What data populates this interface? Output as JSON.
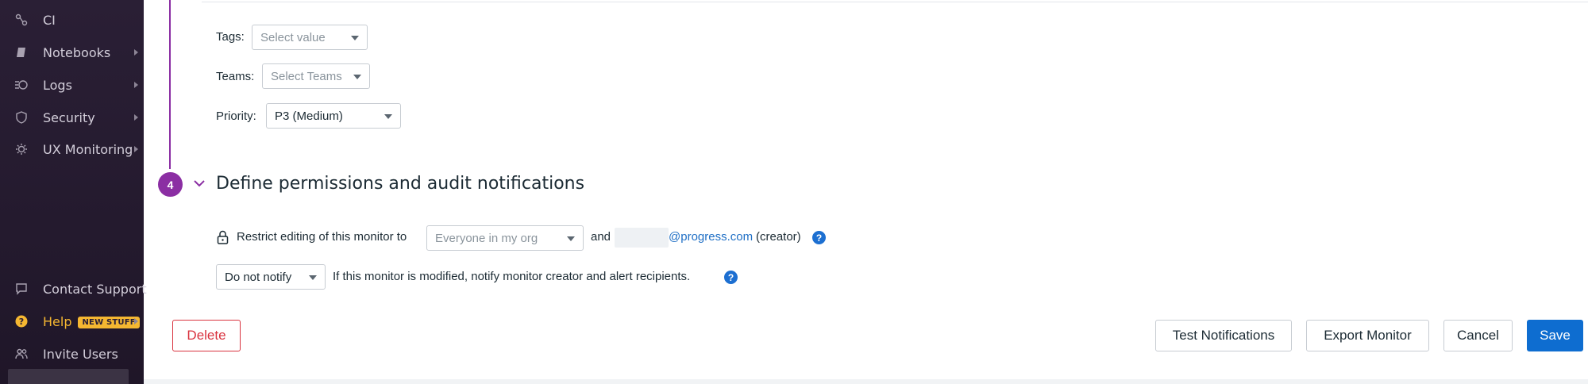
{
  "sidebar": {
    "items": [
      {
        "label": "CI",
        "icon": "ci-pipeline-icon"
      },
      {
        "label": "Notebooks",
        "icon": "notebook-icon"
      },
      {
        "label": "Logs",
        "icon": "logs-icon"
      },
      {
        "label": "Security",
        "icon": "shield-icon"
      },
      {
        "label": "UX Monitoring",
        "icon": "ux-monitoring-icon"
      }
    ],
    "bottom_items": [
      {
        "label": "Contact Support",
        "icon": "chat-icon"
      },
      {
        "label": "Help",
        "icon": "help-icon",
        "badge": "NEW STUFF"
      },
      {
        "label": "Invite Users",
        "icon": "users-icon"
      }
    ]
  },
  "form": {
    "tags_label": "Tags:",
    "tags_placeholder": "Select value",
    "teams_label": "Teams:",
    "teams_placeholder": "Select Teams",
    "priority_label": "Priority:",
    "priority_value": "P3 (Medium)"
  },
  "section": {
    "step_number": "4",
    "title": "Define permissions and audit notifications"
  },
  "permissions": {
    "restrict_label": "Restrict editing of this monitor to",
    "restrict_value": "Everyone in my org",
    "and_text": "and",
    "email": "@progress.com",
    "creator_text": "(creator)",
    "notify_value": "Do not notify",
    "notify_text": "If this monitor is modified, notify monitor creator and alert recipients."
  },
  "actions": {
    "delete": "Delete",
    "test_notifications": "Test Notifications",
    "export_monitor": "Export Monitor",
    "cancel": "Cancel",
    "save": "Save"
  },
  "colors": {
    "accent": "#8b2ea3",
    "primary": "#0e6dd0",
    "danger": "#d9333f",
    "help": "#f5b731"
  }
}
